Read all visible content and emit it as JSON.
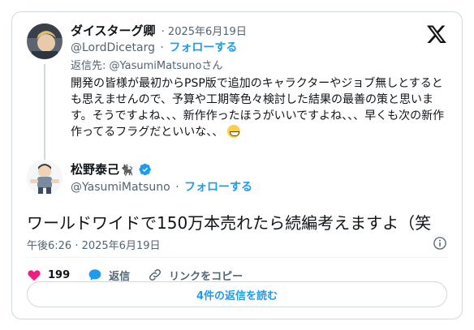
{
  "parent_tweet": {
    "display_name": "ダイスターグ卿",
    "date": "· 2025年6月19日",
    "handle": "@LordDicetarg",
    "follow_label": "フォローする",
    "reply_to_prefix": "返信先: ",
    "reply_to_handle": "@YasumiMatsuno",
    "reply_to_suffix": "さん",
    "body": "開発の皆様が最初からPSP版で追加のキャラクターやジョブ無しとするとも思えませんので、予算や工期等色々検討した結果の最善の策と思います。そうですよね、、、新作作ったほうがいいですよね、、、早くも次の新作作ってるフラグだといいな、、"
  },
  "main_tweet": {
    "display_name": "松野泰己",
    "name_emoji": "🐈‍⬛",
    "handle": "@YasumiMatsuno",
    "follow_label": "フォローする",
    "body": "ワールドワイドで150万本売れたら続編考えますよ（笑",
    "timestamp": "午後6:26 · 2025年6月19日",
    "like_count": "199",
    "reply_label": "返信",
    "copy_link_label": "リンクをコピー",
    "read_replies_label": "4件の返信を読む"
  },
  "colors": {
    "accent": "#1d9bf0",
    "like": "#f91880",
    "text": "#0f1419",
    "muted": "#536471",
    "border": "#cfd9de"
  },
  "icons": [
    "x-logo-icon",
    "verified-badge-icon",
    "info-icon",
    "heart-icon",
    "reply-bubble-icon",
    "link-icon",
    "grin-emoji-icon"
  ]
}
